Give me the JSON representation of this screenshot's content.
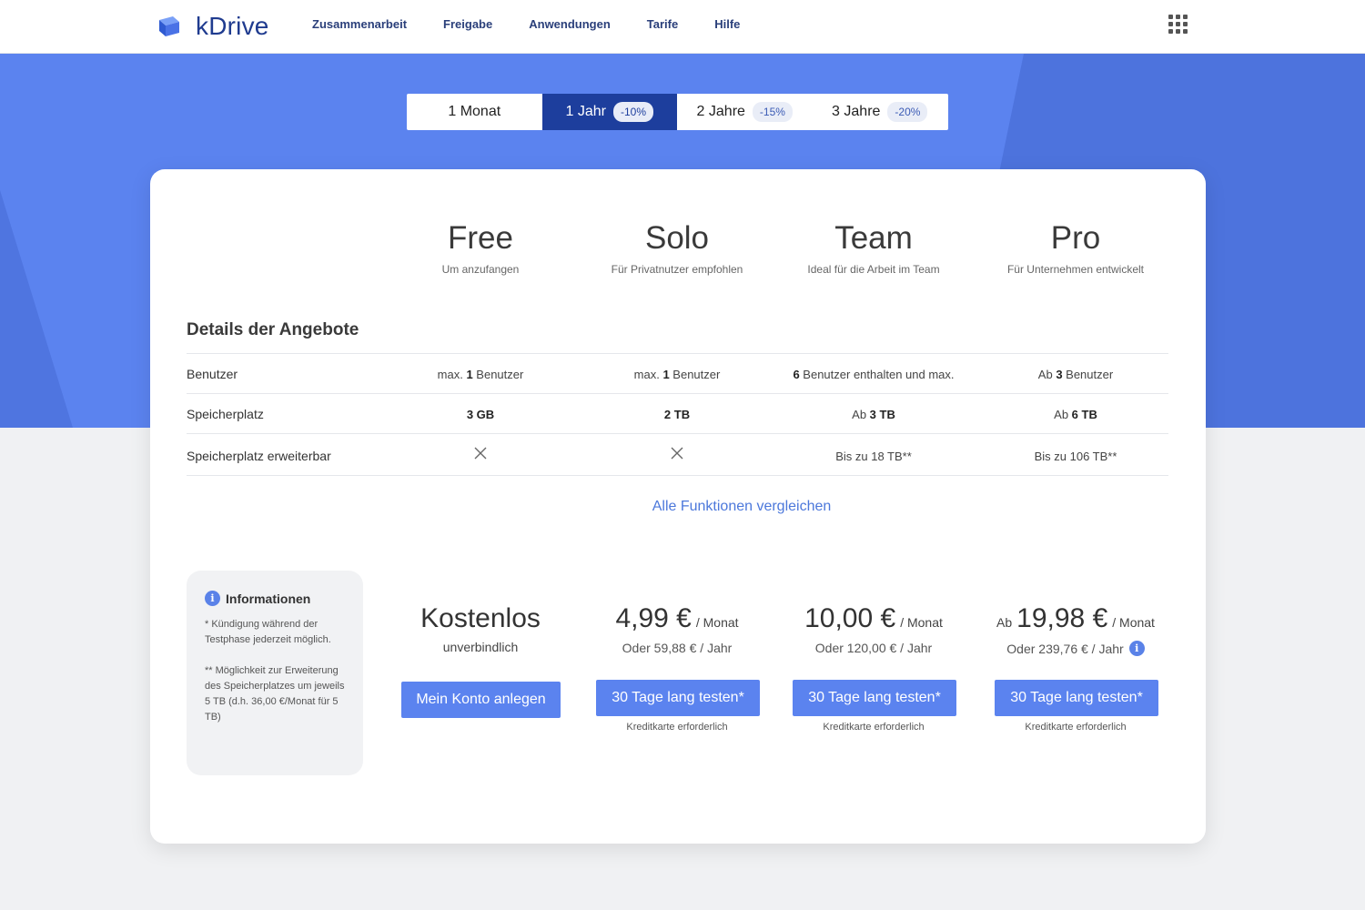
{
  "header": {
    "brand": "kDrive",
    "nav": [
      "Zusammenarbeit",
      "Freigabe",
      "Anwendungen",
      "Tarife",
      "Hilfe"
    ]
  },
  "periods": [
    {
      "label": "1 Monat",
      "badge": "",
      "active": false
    },
    {
      "label": "1 Jahr",
      "badge": "-10%",
      "active": true
    },
    {
      "label": "2 Jahre",
      "badge": "-15%",
      "active": false
    },
    {
      "label": "3 Jahre",
      "badge": "-20%",
      "active": false
    }
  ],
  "plans": [
    {
      "name": "Free",
      "sub": "Um anzufangen"
    },
    {
      "name": "Solo",
      "sub": "Für Privatnutzer empfohlen"
    },
    {
      "name": "Team",
      "sub": "Ideal für die Arbeit im Team"
    },
    {
      "name": "Pro",
      "sub": "Für Unternehmen entwickelt"
    }
  ],
  "details": {
    "title": "Details der Angebote",
    "rows": [
      {
        "label": "Benutzer",
        "cells": [
          {
            "pre": "max. ",
            "bold": "1",
            "post": " Benutzer"
          },
          {
            "pre": "max. ",
            "bold": "1",
            "post": " Benutzer"
          },
          {
            "pre": "",
            "bold": "6",
            "post": " Benutzer enthalten und max."
          },
          {
            "pre": "Ab ",
            "bold": "3",
            "post": " Benutzer"
          }
        ]
      },
      {
        "label": "Speicherplatz",
        "cells": [
          {
            "pre": "",
            "bold": "3 GB",
            "post": ""
          },
          {
            "pre": "",
            "bold": "2 TB",
            "post": ""
          },
          {
            "pre": "Ab ",
            "bold": "3 TB",
            "post": ""
          },
          {
            "pre": "Ab ",
            "bold": "6 TB",
            "post": ""
          }
        ]
      },
      {
        "label": "Speicherplatz erweiterbar",
        "cells": [
          {
            "icon": "x-icon"
          },
          {
            "icon": "x-icon"
          },
          {
            "pre": "Bis zu 18 TB**",
            "bold": "",
            "post": ""
          },
          {
            "pre": "Bis zu 106 TB**",
            "bold": "",
            "post": ""
          }
        ]
      }
    ],
    "compare_link": "Alle Funktionen vergleichen"
  },
  "info": {
    "title": "Informationen",
    "note1": "* Kündigung während der Testphase jederzeit möglich.",
    "note2": "** Möglichkeit zur Erweiterung des Speicherplatzes um jeweils 5 TB (d.h. 36,00 €/Monat für 5 TB)"
  },
  "pricing": {
    "free": {
      "price": "Kostenlos",
      "sub": "unverbindlich",
      "button": "Mein Konto anlegen"
    },
    "solo": {
      "prefix": "",
      "price": "4,99 €",
      "unit": "/ Monat",
      "year": "Oder 59,88 € / Jahr",
      "button": "30 Tage lang testen*",
      "note": "Kreditkarte erforderlich"
    },
    "team": {
      "prefix": "",
      "price": "10,00 €",
      "unit": "/ Monat",
      "year": "Oder 120,00 € / Jahr",
      "button": "30 Tage lang testen*",
      "note": "Kreditkarte erforderlich"
    },
    "pro": {
      "prefix": "Ab",
      "price": "19,98 €",
      "unit": "/ Monat",
      "year": "Oder 239,76 € / Jahr",
      "button": "30 Tage lang testen*",
      "note": "Kreditkarte erforderlich"
    }
  },
  "colors": {
    "accent": "#5b83ef",
    "navy": "#1d3e9d",
    "link": "#4c78db"
  }
}
